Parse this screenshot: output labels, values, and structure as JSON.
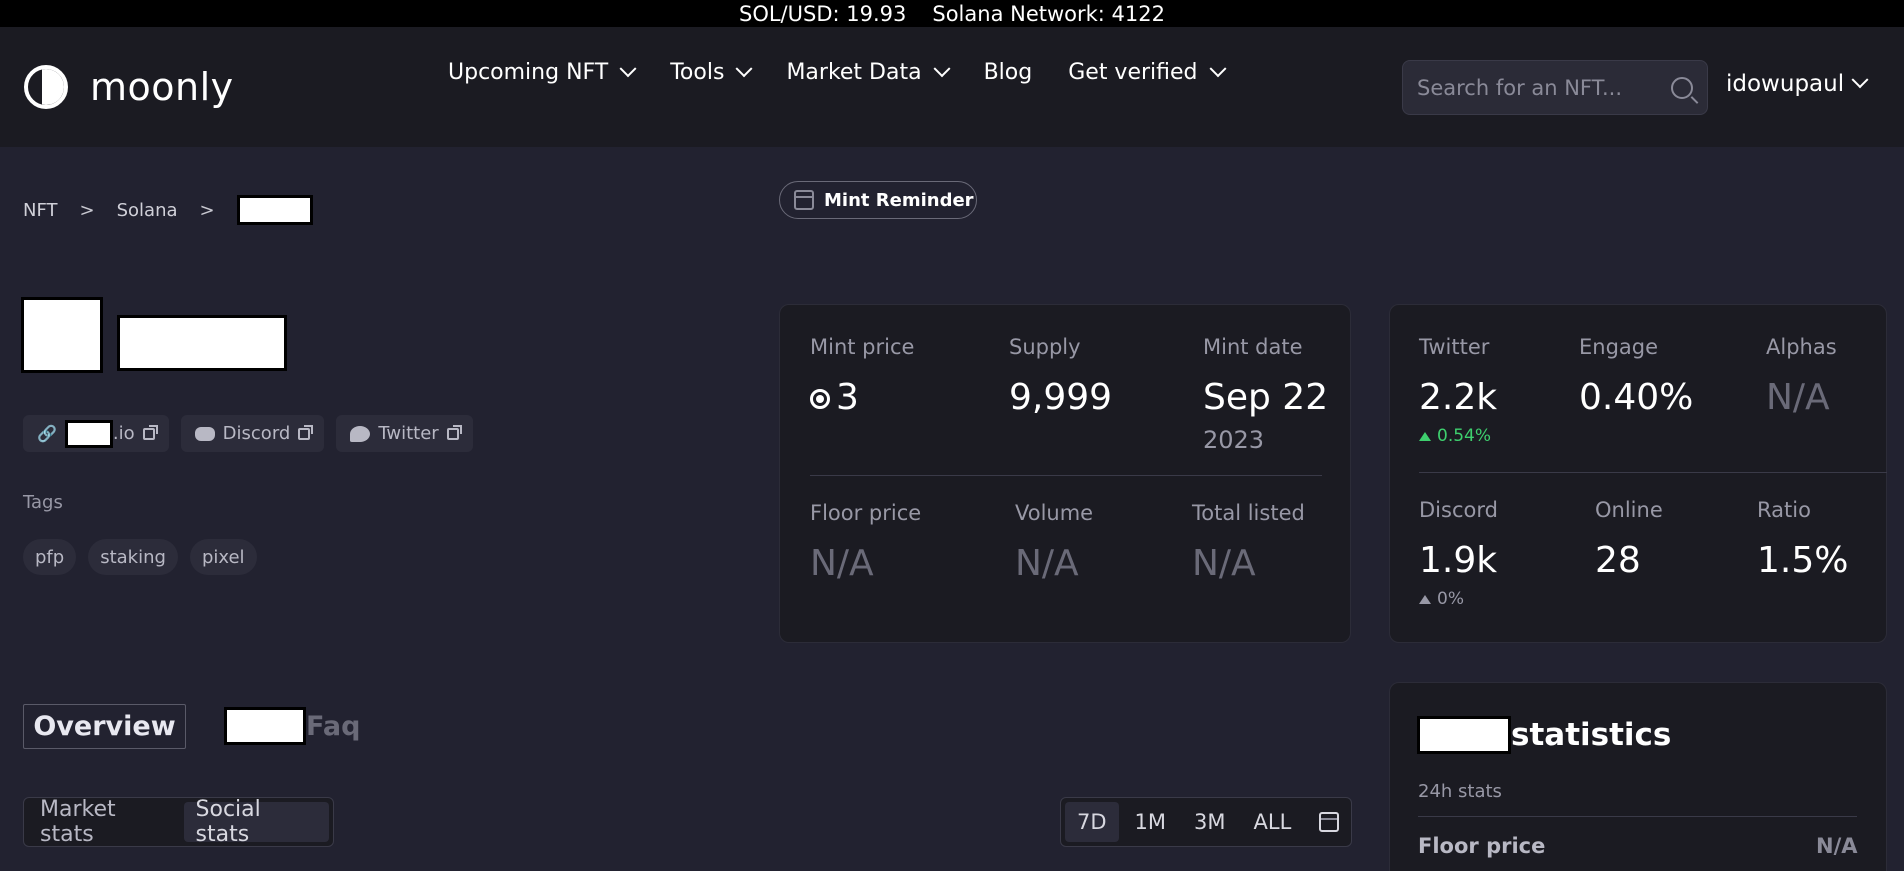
{
  "ticker": {
    "sol_usd": "SOL/USD: 19.93",
    "network": "Solana Network: 4122"
  },
  "header": {
    "logo_text": "moonly",
    "nav": [
      "Upcoming NFT",
      "Tools",
      "Market Data",
      "Blog",
      "Get verified"
    ],
    "search_placeholder": "Search for an NFT...",
    "username": "idowupaul"
  },
  "breadcrumb": {
    "items": [
      "NFT",
      "Solana"
    ],
    "sep": ">"
  },
  "mint_reminder": "Mint Reminder",
  "links": {
    "website_suffix": ".io",
    "discord": "Discord",
    "twitter": "Twitter"
  },
  "tags": {
    "label": "Tags",
    "items": [
      "pfp",
      "staking",
      "pixel"
    ]
  },
  "mint_card": {
    "mint_price_label": "Mint price",
    "mint_price": "3",
    "supply_label": "Supply",
    "supply": "9,999",
    "mint_date_label": "Mint date",
    "mint_date": "Sep 22",
    "mint_year": "2023",
    "floor_label": "Floor price",
    "floor": "N/A",
    "volume_label": "Volume",
    "volume": "N/A",
    "listed_label": "Total listed",
    "listed": "N/A"
  },
  "social_card": {
    "twitter_label": "Twitter",
    "twitter": "2.2k",
    "twitter_delta": "0.54%",
    "engage_label": "Engage",
    "engage": "0.40%",
    "alphas_label": "Alphas",
    "alphas": "N/A",
    "discord_label": "Discord",
    "discord": "1.9k",
    "discord_delta": "0%",
    "online_label": "Online",
    "online": "28",
    "ratio_label": "Ratio",
    "ratio": "1.5%"
  },
  "tabs": {
    "overview": "Overview",
    "faq": "Faq"
  },
  "segments": [
    "Market stats",
    "Social stats"
  ],
  "ranges": [
    "7D",
    "1M",
    "3M",
    "ALL"
  ],
  "statistics": {
    "title": "statistics",
    "sub": "24h stats",
    "floor_label": "Floor price",
    "floor": "N/A"
  },
  "colors": {
    "accent_green": "#3ecf6e",
    "bg": "#222230",
    "card": "#1b1b22"
  }
}
